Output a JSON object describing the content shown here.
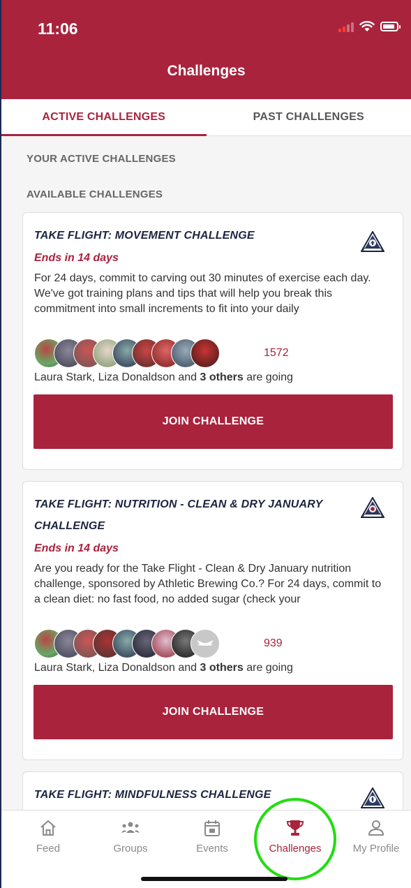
{
  "status": {
    "time": "11:06"
  },
  "header": {
    "title": "Challenges"
  },
  "tabs": [
    {
      "label": "ACTIVE CHALLENGES",
      "active": true
    },
    {
      "label": "PAST CHALLENGES",
      "active": false
    }
  ],
  "sections": {
    "active_label": "YOUR ACTIVE CHALLENGES",
    "available_label": "AVAILABLE CHALLENGES"
  },
  "challenges": [
    {
      "title_line1": "TAKE FLIGHT: MOVEMENT CHALLENGE",
      "title_line2": "",
      "badge_icon": "movement-badge-icon",
      "ends": "Ends in 14 days",
      "description": "For 24 days, commit to carving out 30 minutes of exercise each day. We've got training plans and tips that will help you break this commitment into small increments to fit into your daily",
      "participant_count": "1572",
      "going_names": "Laura Stark, Liza Donaldson",
      "going_and": "and",
      "going_others": "3 others",
      "going_suffix": "are going",
      "join_label": "JOIN CHALLENGE"
    },
    {
      "title_line1": "TAKE FLIGHT: NUTRITION - CLEAN & DRY JANUARY",
      "title_line2": "CHALLENGE",
      "badge_icon": "nutrition-badge-icon",
      "ends": "Ends in 14 days",
      "description": "Are you ready for the Take Flight - Clean & Dry January nutrition challenge, sponsored by Athletic Brewing Co.? For 24 days, commit to a clean diet: no fast food, no added sugar (check your",
      "participant_count": "939",
      "going_names": "Laura Stark, Liza Donaldson",
      "going_and": "and",
      "going_others": "3 others",
      "going_suffix": "are going",
      "join_label": "JOIN CHALLENGE"
    },
    {
      "title_line1": "TAKE FLIGHT: MINDFULNESS CHALLENGE",
      "badge_icon": "mindfulness-badge-icon"
    }
  ],
  "tabbar": [
    {
      "label": "Feed",
      "icon": "home-icon"
    },
    {
      "label": "Groups",
      "icon": "groups-icon"
    },
    {
      "label": "Events",
      "icon": "calendar-icon"
    },
    {
      "label": "Challenges",
      "icon": "trophy-icon",
      "active": true
    },
    {
      "label": "My Profile",
      "icon": "person-icon"
    }
  ],
  "colors": {
    "brand": "#a9233d",
    "title_navy": "#1c2440",
    "highlight": "#22dd11"
  }
}
